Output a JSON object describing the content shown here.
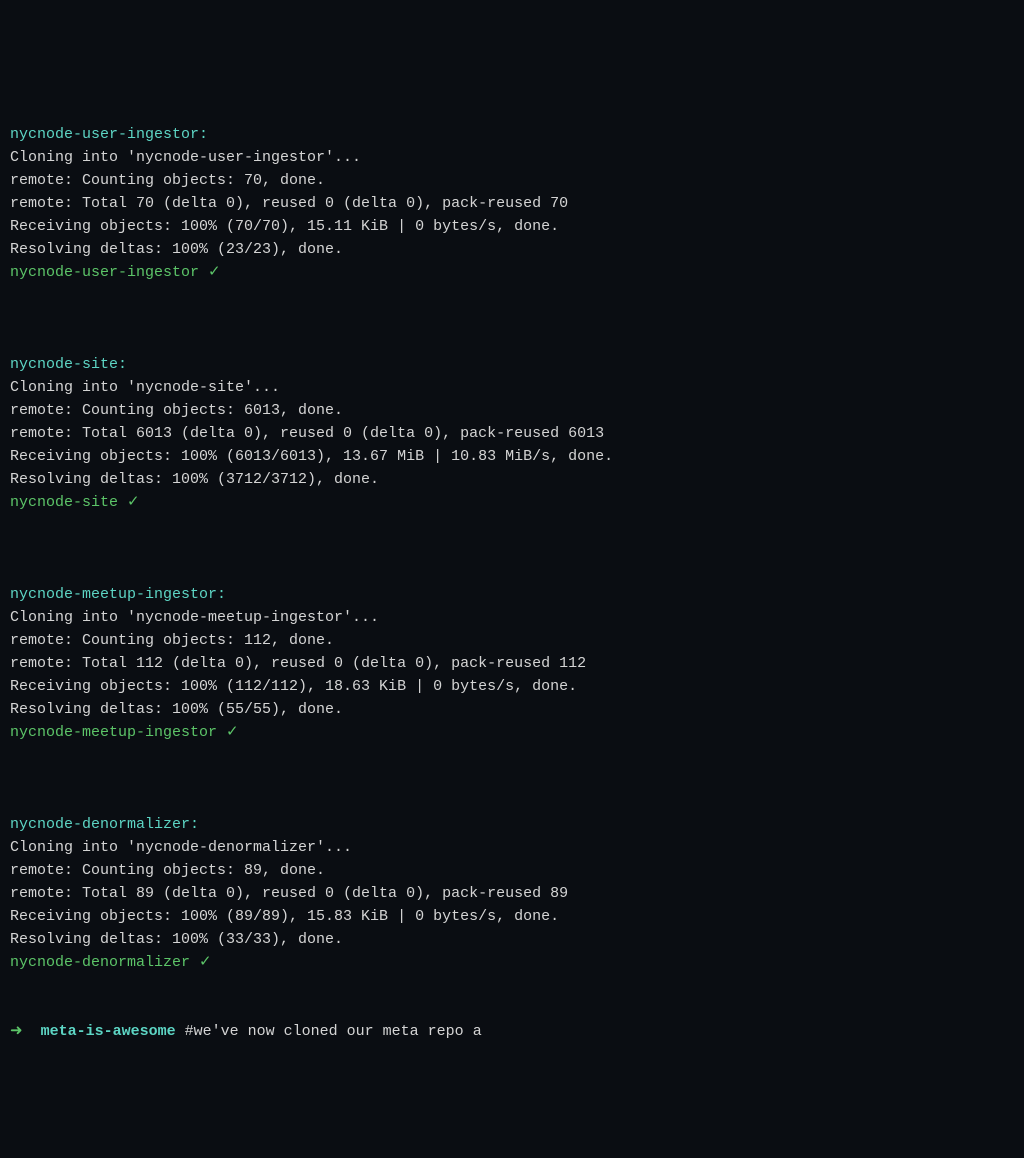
{
  "repos": [
    {
      "name": "nycnode-user-ingestor",
      "header": "nycnode-user-ingestor:",
      "lines": [
        "Cloning into 'nycnode-user-ingestor'...",
        "remote: Counting objects: 70, done.",
        "remote: Total 70 (delta 0), reused 0 (delta 0), pack-reused 70",
        "Receiving objects: 100% (70/70), 15.11 KiB | 0 bytes/s, done.",
        "Resolving deltas: 100% (23/23), done."
      ],
      "success": "nycnode-user-ingestor ✓"
    },
    {
      "name": "nycnode-site",
      "header": "nycnode-site:",
      "lines": [
        "Cloning into 'nycnode-site'...",
        "remote: Counting objects: 6013, done.",
        "remote: Total 6013 (delta 0), reused 0 (delta 0), pack-reused 6013",
        "Receiving objects: 100% (6013/6013), 13.67 MiB | 10.83 MiB/s, done.",
        "Resolving deltas: 100% (3712/3712), done."
      ],
      "success": "nycnode-site ✓"
    },
    {
      "name": "nycnode-meetup-ingestor",
      "header": "nycnode-meetup-ingestor:",
      "lines": [
        "Cloning into 'nycnode-meetup-ingestor'...",
        "remote: Counting objects: 112, done.",
        "remote: Total 112 (delta 0), reused 0 (delta 0), pack-reused 112",
        "Receiving objects: 100% (112/112), 18.63 KiB | 0 bytes/s, done.",
        "Resolving deltas: 100% (55/55), done."
      ],
      "success": "nycnode-meetup-ingestor ✓"
    },
    {
      "name": "nycnode-denormalizer",
      "header": "nycnode-denormalizer:",
      "lines": [
        "Cloning into 'nycnode-denormalizer'...",
        "remote: Counting objects: 89, done.",
        "remote: Total 89 (delta 0), reused 0 (delta 0), pack-reused 89",
        "Receiving objects: 100% (89/89), 15.83 KiB | 0 bytes/s, done.",
        "Resolving deltas: 100% (33/33), done."
      ],
      "success": "nycnode-denormalizer ✓"
    }
  ],
  "prompt": {
    "arrow": "➜",
    "dir": "meta-is-awesome",
    "command": "#we've now cloned our meta repo a"
  }
}
